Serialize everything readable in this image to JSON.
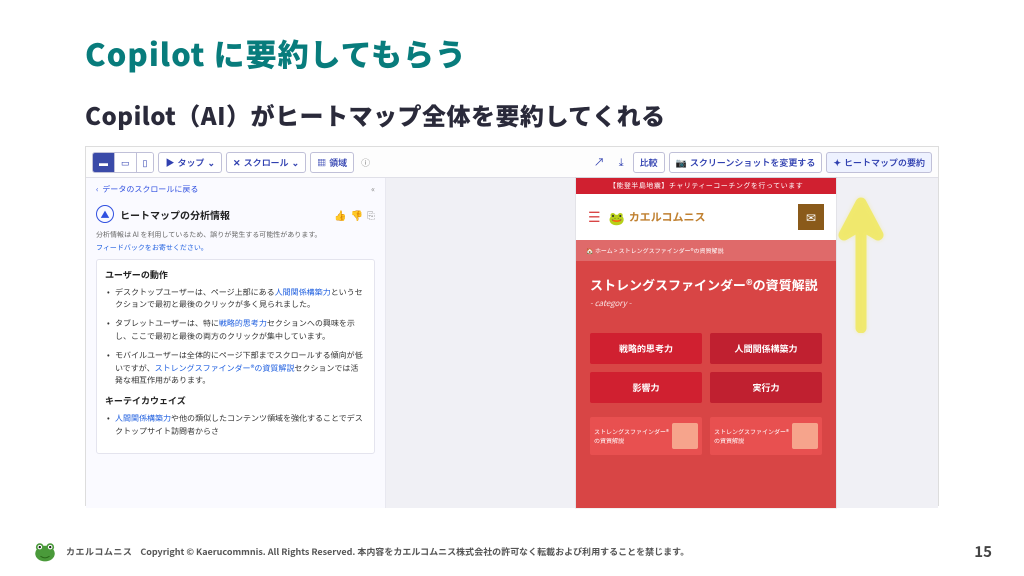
{
  "title": "Copilot に要約してもらう",
  "subtitle": "Copilot（AI）がヒートマップ全体を要約してくれる",
  "toolbar": {
    "tap": "タップ",
    "scroll": "スクロール",
    "region": "領域",
    "compare": "比較",
    "screenshot": "スクリーンショットを変更する",
    "summary": "ヒートマップの要約"
  },
  "left": {
    "back": "データのスクロールに戻る",
    "panel_title": "ヒートマップの分析情報",
    "warn": "分析情報は AI を利用しているため、誤りが発生する可能性があります。",
    "feedback": "フィードバックをお寄せください。",
    "section1_title": "ユーザーの動作",
    "items1": [
      {
        "pre": "デスクトップユーザーは、ページ上部にある",
        "link": "人間関係構築力",
        "post": "というセクションで最初と最後のクリックが多く見られました。"
      },
      {
        "pre": "タブレットユーザーは、特に",
        "link": "戦略的思考力",
        "post": "セクションへの興味を示し、ここで最初と最後の両方のクリックが集中しています。"
      },
      {
        "pre": "モバイルユーザーは全体的にページ下部までスクロールする傾向が低いですが、",
        "link": "ストレングスファインダー®の資質解説",
        "post": "セクションでは活発な相互作用があります。"
      }
    ],
    "section2_title": "キーテイカウェイズ",
    "items2": [
      {
        "link": "人間関係構築力",
        "post": "や他の類似したコンテンツ領域を強化することでデスクトップサイト訪問者からさ"
      }
    ]
  },
  "phone": {
    "banner": "【能登半島地震】チャリティーコーチングを行っています",
    "brand": "カエルコムニス",
    "breadcrumb": "ホーム > ストレングスファインダー®の資質解説",
    "main_title": "ストレングスファインダー®の資質解説",
    "category": "- category -",
    "buttons": [
      "戦略的思考力",
      "人間関係構築力",
      "影響力",
      "実行力"
    ],
    "thumb_text": "ストレングスファインダー®の資質解説"
  },
  "footer": {
    "brand": "カエルコムニス",
    "copyright": "Copyright © Kaerucommnis. All Rights Reserved. 本内容をカエルコムニス株式会社の許可なく転載および利用することを禁じます。",
    "page": "15"
  }
}
